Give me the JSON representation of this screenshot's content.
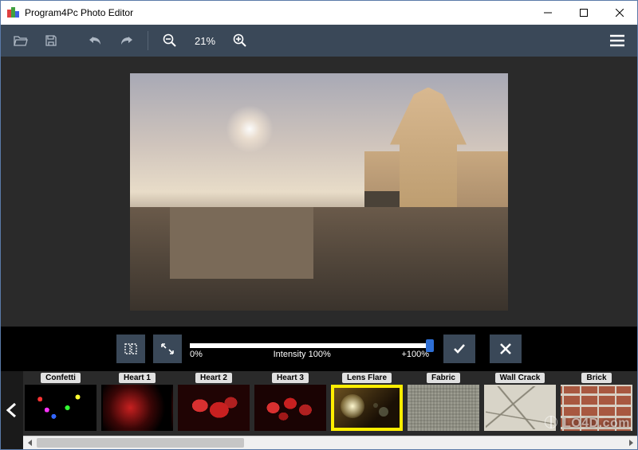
{
  "title": "Program4Pc Photo Editor",
  "toolbar": {
    "zoom_text": "21%"
  },
  "effect_controls": {
    "min_label": "0%",
    "mid_label": "Intensity  100%",
    "max_label": "+100%"
  },
  "effects": [
    {
      "label": "Confetti",
      "selected": false,
      "css": "th-confetti"
    },
    {
      "label": "Heart 1",
      "selected": false,
      "css": "th-heart1"
    },
    {
      "label": "Heart 2",
      "selected": false,
      "css": "th-heart2"
    },
    {
      "label": "Heart 3",
      "selected": false,
      "css": "th-heart3"
    },
    {
      "label": "Lens Flare",
      "selected": true,
      "css": "th-lensflare"
    },
    {
      "label": "Fabric",
      "selected": false,
      "css": "th-fabric"
    },
    {
      "label": "Wall Crack",
      "selected": false,
      "css": "th-wallcrack"
    },
    {
      "label": "Brick",
      "selected": false,
      "css": "th-brick"
    }
  ],
  "watermark": "LO4D.com"
}
